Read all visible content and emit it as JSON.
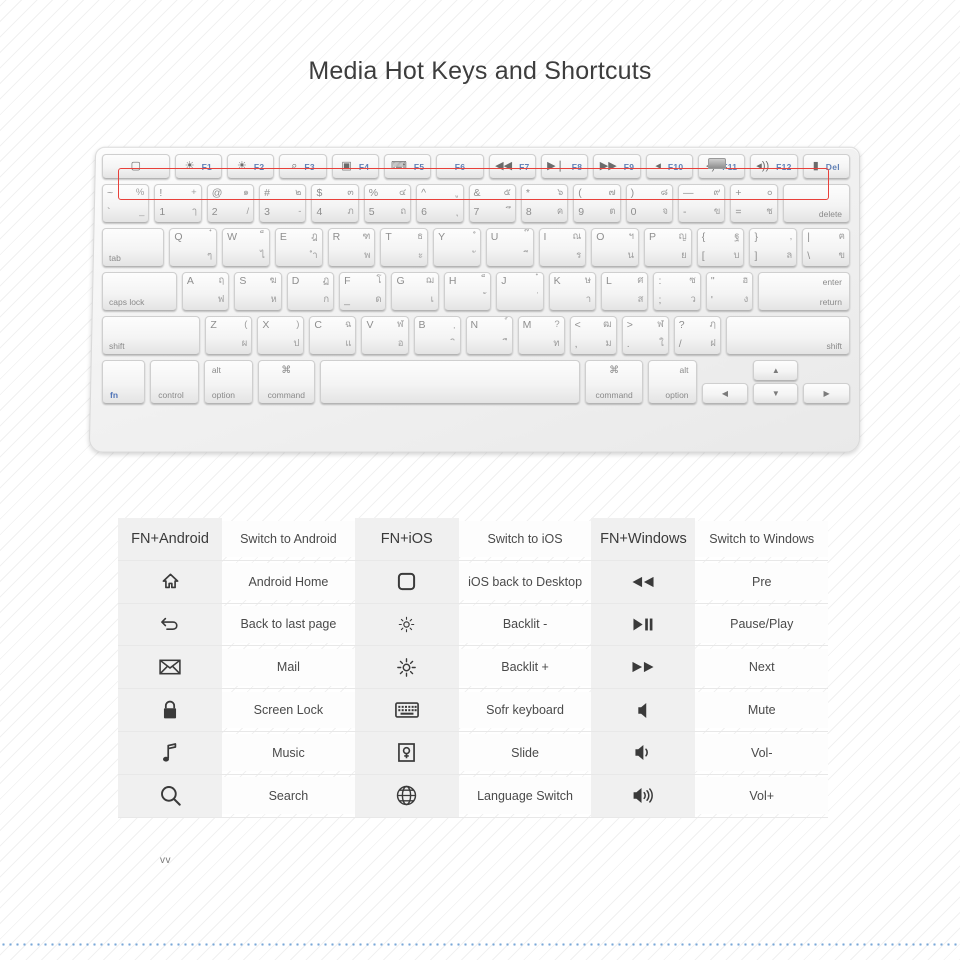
{
  "page": {
    "title": "Media Hot Keys and Shortcuts",
    "footer_note": "vv"
  },
  "keyboard": {
    "highlight_color": "#e8403a",
    "fn_row": [
      {
        "glyph": "▢",
        "label": ""
      },
      {
        "glyph": "☀",
        "label": "F1"
      },
      {
        "glyph": "☀",
        "label": "F2"
      },
      {
        "glyph": "⌕",
        "label": "F3"
      },
      {
        "glyph": "▣",
        "label": "F4"
      },
      {
        "glyph": "⌨",
        "label": "F5"
      },
      {
        "glyph": "",
        "label": "F6"
      },
      {
        "glyph": "◀◀",
        "label": "F7"
      },
      {
        "glyph": "▶❘",
        "label": "F8"
      },
      {
        "glyph": "▶▶",
        "label": "F9"
      },
      {
        "glyph": "◂",
        "label": "F10"
      },
      {
        "glyph": "◂)",
        "label": "F11"
      },
      {
        "glyph": "◂))",
        "label": "F12"
      },
      {
        "glyph": "▮",
        "label": "Del"
      }
    ],
    "num_row": [
      {
        "tl": "~",
        "tr": "%",
        "bl": "`",
        "br": "_"
      },
      {
        "tl": "!",
        "tr": "+",
        "bl": "1",
        "br": "ๅ"
      },
      {
        "tl": "@",
        "tr": "๑",
        "bl": "2",
        "br": "/"
      },
      {
        "tl": "#",
        "tr": "๒",
        "bl": "3",
        "br": "-"
      },
      {
        "tl": "$",
        "tr": "๓",
        "bl": "4",
        "br": "ภ"
      },
      {
        "tl": "%",
        "tr": "๔",
        "bl": "5",
        "br": "ถ"
      },
      {
        "tl": "^",
        "tr": "ู",
        "bl": "6",
        "br": "ุ"
      },
      {
        "tl": "&",
        "tr": "๕",
        "bl": "7",
        "br": "ึ"
      },
      {
        "tl": "*",
        "tr": "๖",
        "bl": "8",
        "br": "ค"
      },
      {
        "tl": "(",
        "tr": "๗",
        "bl": "9",
        "br": "ต"
      },
      {
        "tl": ")",
        "tr": "๘",
        "bl": "0",
        "br": "จ"
      },
      {
        "tl": "—",
        "tr": "๙",
        "bl": "-",
        "br": "ข"
      },
      {
        "tl": "+",
        "tr": "๐",
        "bl": "=",
        "br": "ช"
      }
    ],
    "num_row_last": "delete",
    "q_row_first": "tab",
    "q_row": [
      {
        "tl": "Q",
        "tr": "๋",
        "bl": "",
        "br": "ๆ"
      },
      {
        "tl": "W",
        "tr": "็",
        "bl": "",
        "br": "ไ"
      },
      {
        "tl": "E",
        "tr": "ฎ",
        "bl": "",
        "br": "ำ"
      },
      {
        "tl": "R",
        "tr": "ฑ",
        "bl": "",
        "br": "พ"
      },
      {
        "tl": "T",
        "tr": "ธ",
        "bl": "",
        "br": "ะ"
      },
      {
        "tl": "Y",
        "tr": "ํ",
        "bl": "",
        "br": "ั"
      },
      {
        "tl": "U",
        "tr": "๊",
        "bl": "",
        "br": "ี"
      },
      {
        "tl": "I",
        "tr": "ณ",
        "bl": "",
        "br": "ร"
      },
      {
        "tl": "O",
        "tr": "ฯ",
        "bl": "",
        "br": "น"
      },
      {
        "tl": "P",
        "tr": "ญ",
        "bl": "",
        "br": "ย"
      },
      {
        "tl": "{",
        "tr": "ฐ",
        "bl": "[",
        "br": "บ"
      },
      {
        "tl": "}",
        "tr": ",",
        "bl": "]",
        "br": "ล"
      },
      {
        "tl": "|",
        "tr": "ฅ",
        "bl": "\\",
        "br": "ข"
      }
    ],
    "a_row_first": "caps lock",
    "a_row": [
      {
        "tl": "A",
        "tr": "ฤ",
        "bl": "",
        "br": "ฟ"
      },
      {
        "tl": "S",
        "tr": "ฆ",
        "bl": "",
        "br": "ห"
      },
      {
        "tl": "D",
        "tr": "ฏ",
        "bl": "",
        "br": "ก"
      },
      {
        "tl": "F",
        "tr": "โ",
        "bl": "_",
        "br": "ด"
      },
      {
        "tl": "G",
        "tr": "ฌ",
        "bl": "",
        "br": "เ"
      },
      {
        "tl": "H",
        "tr": "็",
        "bl": "",
        "br": "้"
      },
      {
        "tl": "J",
        "tr": "๋",
        "bl": "",
        "br": "่"
      },
      {
        "tl": "K",
        "tr": "ษ",
        "bl": "",
        "br": "า"
      },
      {
        "tl": "L",
        "tr": "ศ",
        "bl": "",
        "br": "ส"
      },
      {
        "tl": ":",
        "tr": "ซ",
        "bl": ";",
        "br": "ว"
      },
      {
        "tl": "\"",
        "tr": "ฮ",
        "bl": "'",
        "br": "ง"
      }
    ],
    "a_row_enter": {
      "top": "enter",
      "bottom": "return"
    },
    "z_row_first": "shift",
    "z_row": [
      {
        "tl": "Z",
        "tr": "(",
        "bl": "",
        "br": "ผ"
      },
      {
        "tl": "X",
        "tr": ")",
        "bl": "",
        "br": "ป"
      },
      {
        "tl": "C",
        "tr": "ฉ",
        "bl": "",
        "br": "แ"
      },
      {
        "tl": "V",
        "tr": "ฬ",
        "bl": "",
        "br": "อ"
      },
      {
        "tl": "B",
        "tr": "ฺ",
        "bl": "",
        "br": "ิ"
      },
      {
        "tl": "N",
        "tr": "์",
        "bl": "",
        "br": "ื"
      },
      {
        "tl": "M",
        "tr": "?",
        "bl": "",
        "br": "ท"
      },
      {
        "tl": "<",
        "tr": "ฒ",
        "bl": ",",
        "br": "ม"
      },
      {
        "tl": ">",
        "tr": "ฬ",
        "bl": ".",
        "br": "ใ"
      },
      {
        "tl": "?",
        "tr": "ฦ",
        "bl": "/",
        "br": "ฝ"
      }
    ],
    "z_row_shift": "shift",
    "mod_row": {
      "fn": "fn",
      "control": "control",
      "alt": "alt",
      "option": "option",
      "command_glyph": "⌘",
      "command": "command",
      "space": "",
      "command_right_glyph": "⌘",
      "command_right": "command",
      "alt_right": "alt",
      "option_right": "option",
      "arrow_left": "◀",
      "arrow_up": "▲",
      "arrow_down": "▼",
      "arrow_right": "▶"
    }
  },
  "shortcut_table": {
    "columns": [
      {
        "id": "android",
        "header_icon": "FN+Android",
        "header_text": "Switch to Android",
        "rows": [
          {
            "icon": "home-arrow-icon",
            "text": "Android Home"
          },
          {
            "icon": "back-arrow-icon",
            "text": "Back to last page"
          },
          {
            "icon": "mail-envelope-icon",
            "text": "Mail"
          },
          {
            "icon": "lock-icon",
            "text": "Screen Lock"
          },
          {
            "icon": "music-note-icon",
            "text": "Music"
          },
          {
            "icon": "search-magnifier-icon",
            "text": "Search"
          }
        ]
      },
      {
        "id": "ios",
        "header_icon": "FN+iOS",
        "header_text": "Switch to iOS",
        "rows": [
          {
            "icon": "rounded-square-icon",
            "text": "iOS back to Desktop"
          },
          {
            "icon": "brightness-down-icon",
            "text": "Backlit -"
          },
          {
            "icon": "brightness-up-icon",
            "text": "Backlit +"
          },
          {
            "icon": "soft-keyboard-icon",
            "text": "Sofr keyboard"
          },
          {
            "icon": "slide-icon",
            "text": "Slide"
          },
          {
            "icon": "globe-icon",
            "text": "Language Switch"
          }
        ]
      },
      {
        "id": "windows",
        "header_icon": "FN+Windows",
        "header_text": "Switch to Windows",
        "rows": [
          {
            "icon": "rewind-icon",
            "text": "Pre"
          },
          {
            "icon": "play-pause-icon",
            "text": "Pause/Play"
          },
          {
            "icon": "fast-forward-icon",
            "text": "Next"
          },
          {
            "icon": "mute-icon",
            "text": "Mute"
          },
          {
            "icon": "volume-down-icon",
            "text": "Vol-"
          },
          {
            "icon": "volume-up-icon",
            "text": "Vol+"
          }
        ]
      }
    ]
  }
}
